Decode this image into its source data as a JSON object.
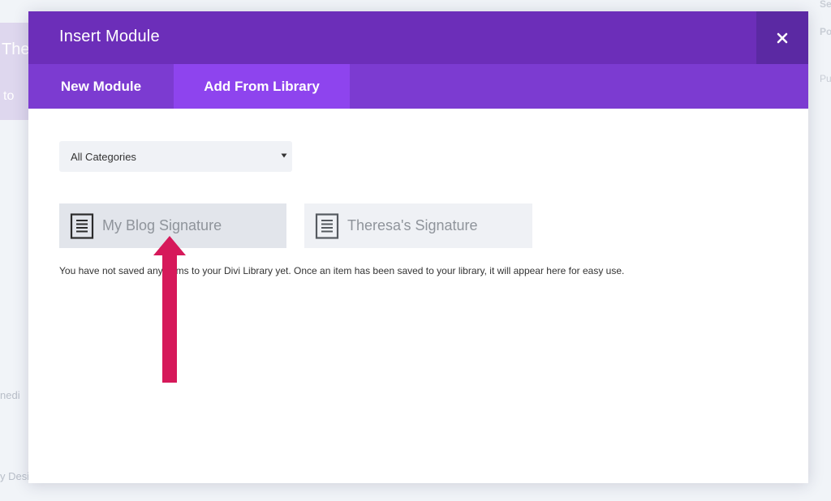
{
  "background": {
    "hero_title": "The",
    "hero_sub": "to",
    "side_label_1": "Se",
    "side_label_2": "Po",
    "side_label_3": "Pu",
    "bottom_text_1": "nedi",
    "bottom_text_2": "y Desi"
  },
  "modal": {
    "title": "Insert Module",
    "close_label": "Close"
  },
  "tabs": [
    {
      "label": "New Module",
      "active": false
    },
    {
      "label": "Add From Library",
      "active": true
    }
  ],
  "category_select": {
    "selected": "All Categories"
  },
  "library_items": [
    {
      "label": "My Blog Signature",
      "icon": "document-icon"
    },
    {
      "label": "Theresa's Signature",
      "icon": "document-icon"
    }
  ],
  "notice": "You have not saved any items to your Divi Library yet. Once an item has been saved to your library, it will appear here for easy use.",
  "colors": {
    "header": "#6c2eb9",
    "tab_bar": "#7c3bd1",
    "tab_active": "#8e44ee",
    "close_bg": "#5b29a3",
    "annotation_arrow": "#d6195a"
  }
}
